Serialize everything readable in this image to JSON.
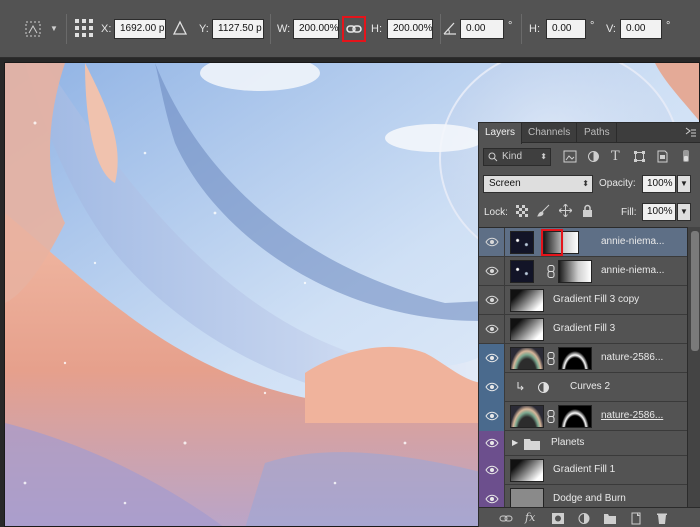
{
  "options_bar": {
    "x_label": "X:",
    "x_value": "1692.00 p",
    "y_label": "Y:",
    "y_value": "1127.50 p",
    "w_label": "W:",
    "w_value": "200.00%",
    "h_label": "H:",
    "h_value": "200.00%",
    "angle_value": "0.00",
    "angle_unit": "°",
    "hskew_label": "H:",
    "hskew_value": "0.00",
    "hskew_unit": "°",
    "vskew_label": "V:",
    "vskew_value": "0.00",
    "vskew_unit": "°"
  },
  "layers_panel": {
    "tabs": [
      {
        "label": "Layers",
        "active": true
      },
      {
        "label": "Channels",
        "active": false
      },
      {
        "label": "Paths",
        "active": false
      }
    ],
    "filter_kind": "Kind",
    "blend_mode": "Screen",
    "opacity_label": "Opacity:",
    "opacity_value": "100%",
    "lock_label": "Lock:",
    "fill_label": "Fill:",
    "fill_value": "100%",
    "layers": [
      {
        "name": "annie-niema...",
        "eye_color": "none",
        "thumb": "stars",
        "mask": "gradient-right",
        "chain": false,
        "selected": true
      },
      {
        "name": "annie-niema...",
        "eye_color": "none",
        "thumb": "stars",
        "mask": "gradient-right",
        "chain": true,
        "selected": false
      },
      {
        "name": "Gradient Fill 3 copy",
        "eye_color": "none",
        "thumb": "gradient-fill",
        "mask": "",
        "chain": false,
        "selected": false
      },
      {
        "name": "Gradient Fill 3",
        "eye_color": "none",
        "thumb": "gradient-fill",
        "mask": "",
        "chain": false,
        "selected": false
      },
      {
        "name": "nature-2586...",
        "eye_color": "blue",
        "thumb": "planet",
        "mask": "black-white-circle",
        "chain": true,
        "selected": false
      },
      {
        "name": "Curves 2",
        "eye_color": "blue",
        "thumb": "curves",
        "mask": "",
        "chain": false,
        "selected": false
      },
      {
        "name": "nature-2586...",
        "eye_color": "blue",
        "thumb": "planet",
        "mask": "black-white-circle",
        "chain": true,
        "selected": false,
        "underline": true
      },
      {
        "name": "Planets",
        "eye_color": "purple",
        "thumb": "folder",
        "mask": "",
        "chain": false,
        "selected": false
      },
      {
        "name": "Gradient Fill 1",
        "eye_color": "purple",
        "thumb": "gradient-fill",
        "mask": "",
        "chain": false,
        "selected": false
      },
      {
        "name": "Dodge and Burn",
        "eye_color": "purple",
        "thumb": "gray",
        "mask": "",
        "chain": false,
        "selected": false
      }
    ]
  },
  "colors": {
    "accent_red": "#e4141b",
    "selection_blue": "#5e6f86",
    "label_blue": "#4a6a8d",
    "label_purple": "#6c4f8d"
  }
}
